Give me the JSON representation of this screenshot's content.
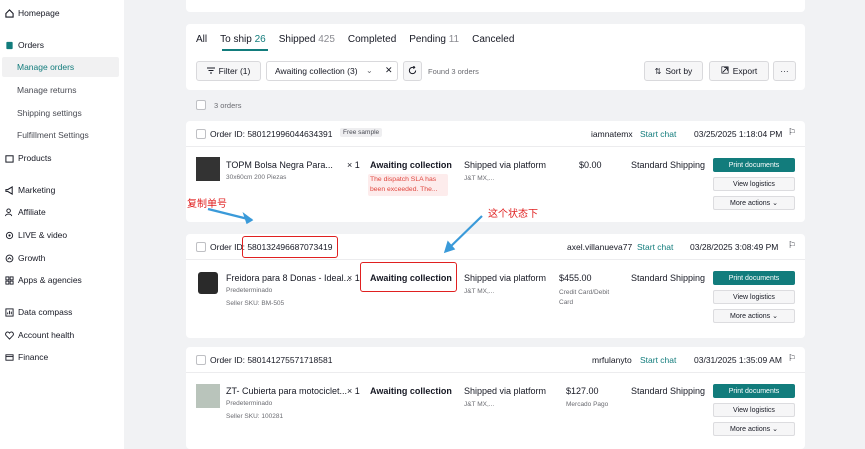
{
  "sidebar": {
    "homepage": "Homepage",
    "orders": "Orders",
    "manage_orders": "Manage orders",
    "manage_returns": "Manage returns",
    "shipping_settings": "Shipping settings",
    "fulfillment_settings": "Fulfillment Settings",
    "products": "Products",
    "marketing": "Marketing",
    "affiliate": "Affiliate",
    "live_video": "LIVE & video",
    "growth": "Growth",
    "apps_agencies": "Apps & agencies",
    "data_compass": "Data compass",
    "account_health": "Account health",
    "finance": "Finance"
  },
  "tabs": [
    {
      "label": "All",
      "count": ""
    },
    {
      "label": "To ship",
      "count": "26"
    },
    {
      "label": "Shipped",
      "count": "425"
    },
    {
      "label": "Completed",
      "count": ""
    },
    {
      "label": "Pending",
      "count": "11"
    },
    {
      "label": "Canceled",
      "count": ""
    }
  ],
  "toolbar": {
    "filter_label": "Filter",
    "filter_count": "(1)",
    "status_filter": "Awaiting collection (3)",
    "found": "Found 3 orders",
    "sort_label": "Sort by",
    "export_label": "Export",
    "more_label": "···"
  },
  "select_all": "3 orders",
  "orders": [
    {
      "id_label": "Order ID:",
      "id": "580121996044634391",
      "badge": "Free sample",
      "buyer": "iamnatemx",
      "chat": "Start chat",
      "date": "03/25/2025 1:18:04 PM",
      "product": "TOPM Bolsa Negra Para...",
      "variant": "30x60cm 200 Piezas",
      "sku": "",
      "qty": "× 1",
      "status": "Awaiting collection",
      "sla": "The dispatch SLA has been exceeded. The...",
      "ship_via": "Shipped via platform",
      "carrier": "J&T MX,...",
      "price": "$0.00",
      "payment": "",
      "shipping": "Standard Shipping",
      "print": "Print documents",
      "logistics": "View logistics",
      "more": "More actions"
    },
    {
      "id_label": "Order ID:",
      "id": "580132496687073419",
      "badge": "",
      "buyer": "axel.villanueva77",
      "chat": "Start chat",
      "date": "03/28/2025 3:08:49 PM",
      "product": "Freidora para 8 Donas - Ideal...",
      "variant": "Predeterminado",
      "sku": "Seller SKU: BM-505",
      "qty": "× 1",
      "status": "Awaiting collection",
      "sla": "",
      "ship_via": "Shipped via platform",
      "carrier": "J&T MX,...",
      "price": "$455.00",
      "payment": "Credit Card/Debit Card",
      "shipping": "Standard Shipping",
      "print": "Print documents",
      "logistics": "View logistics",
      "more": "More actions"
    },
    {
      "id_label": "Order ID:",
      "id": "580141275571718581",
      "badge": "",
      "buyer": "mrfulanyto",
      "chat": "Start chat",
      "date": "03/31/2025 1:35:09 AM",
      "product": "ZT- Cubierta para motociclet...",
      "variant": "Predeterminado",
      "sku": "Seller SKU: 100281",
      "qty": "× 1",
      "status": "Awaiting collection",
      "sla": "",
      "ship_via": "Shipped via platform",
      "carrier": "J&T MX,...",
      "price": "$127.00",
      "payment": "Mercado Pago",
      "shipping": "Standard Shipping",
      "print": "Print documents",
      "logistics": "View logistics",
      "more": "More actions"
    }
  ],
  "annotations": {
    "copy_order_no": "复制单号",
    "this_status": "这个状态下"
  },
  "colors": {
    "accent": "#127c7c",
    "annotation": "#e02020",
    "arrow": "#3a9ad9"
  }
}
